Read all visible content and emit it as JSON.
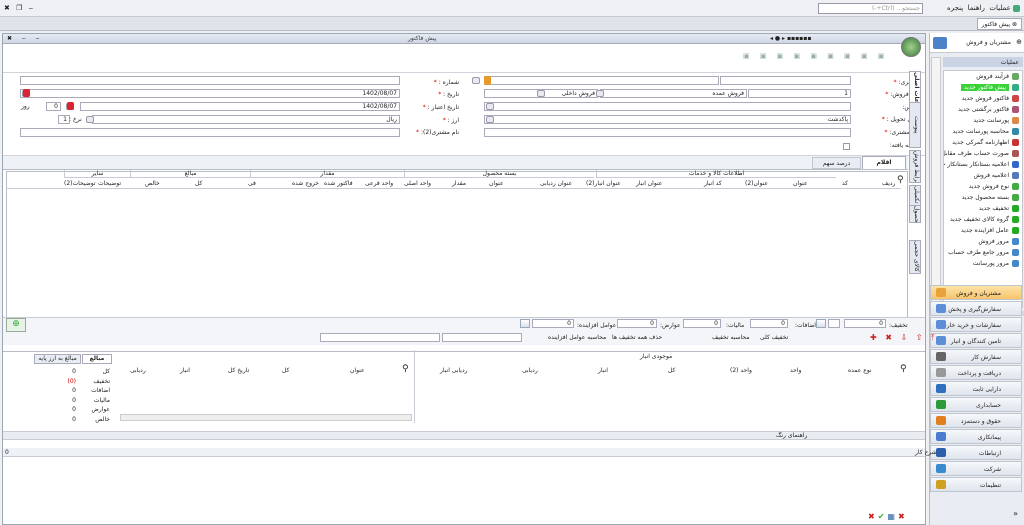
{
  "app": {
    "menus": [
      "عملیات",
      "راهنما",
      "پنجره"
    ],
    "search_placeholder": "جستجو... (Ctrl+-)",
    "doc_tab": "پیش فاکتور"
  },
  "nav": {
    "title": "مشتریان و فروش",
    "section": "عملیات",
    "items": [
      "فرآیند فروش",
      "پیش فاکتور جدید",
      "فاکتور فروش جدید",
      "فاکتور برگشتی جدید",
      "پورسانت جدید",
      "محاسبه پورسانت جدید",
      "اظهارنامه گمرکی جدید",
      "صورت حساب طرف مقابل جدید",
      "اعلامیه بستانکار بستانکار جدید",
      "اعلامیه فروش",
      "نوع فروش جدید",
      "بسته محصول جدید",
      "تخفیف جدید",
      "گروه کالای تخفیف جدید",
      "عامل افزاینده جدید",
      "مرور فروش",
      "مرور جامع طرف حساب",
      "مرور پورسانت"
    ],
    "modules": [
      "مشتریان و فروش",
      "سفارش‌گیری و پخش",
      "سفارشات و خرید خارجی",
      "تامین کنندگان و انبار",
      "سفارش کار",
      "دریافت و پرداخت",
      "دارایی ثابت",
      "حسابداری",
      "حقوق و دستمزد",
      "پیمانکاری",
      "ارتباطات",
      "شرکت",
      "تنظیمات"
    ]
  },
  "form": {
    "window_title": "پیش فاکتور",
    "customer_label": "مشتری:",
    "sale_type_label": "نوع فروش:",
    "sale_type_code": "1",
    "sale_type_value": "فروش عمده",
    "sale_kind": "فروش داخلی",
    "address_label": "آدرس:",
    "delivery_label": "محل تحویل :",
    "delivery_value": "پاکدشت",
    "customer_name_label": "نام مشتری:",
    "end_label": "خاتمه یافته:",
    "number_label": "شماره :",
    "date_label": "تاریخ :",
    "date_value": "1402/08/07",
    "validity_label": "تاریخ اعتبار :",
    "validity_value": "1402/08/07",
    "days_value": "0",
    "days_label": "روز",
    "currency_label": "ارز :",
    "currency_value": "ریال",
    "rate_label": "نرخ :",
    "rate_value": "1",
    "customer2_label": "نام مشتری(2):"
  },
  "items_tabs": [
    "اقلام",
    "درصد سهم"
  ],
  "side_tabs": [
    "اطلاعات اصلی",
    "پیوست",
    "شرایط فروش",
    "اطلاعات تکمیلی",
    "بسته محصول",
    "جوایز کالای حجمی"
  ],
  "grid": {
    "groups": [
      "اطلاعات کالا و خدمات",
      "بسته محصول",
      "مقدار",
      "مبالغ",
      "سایر"
    ],
    "cols": [
      "ردیف",
      "کد",
      "عنوان",
      "عنوان(2)",
      "کد انبار",
      "عنوان انبار",
      "عنوان انبار(2)",
      "عنوان ردیابی",
      "عنوان",
      "مقدار",
      "واحد اصلی",
      "واحد فرعی",
      "فاکتور شده",
      "خروج شده",
      "فی",
      "کل",
      "خالص",
      "توضیحات",
      "توضیحات(2)"
    ]
  },
  "totals": {
    "discount_label": "تخفیف:",
    "discount": "0",
    "additions_label": "اضافات:",
    "taxes_label": "عوارض:",
    "taxes": "0",
    "vat_label": "مالیات:",
    "vat": "0",
    "addition2": "0",
    "incr_label": "عوامل افزاینده:",
    "incr": "0"
  },
  "actions": [
    "تخفیف کلی",
    "محاسبه تخفیف",
    "حذف همه تخفیف ها",
    "محاسبه عوامل افزاینده",
    "حذف عوامل افزاینده"
  ],
  "stock": {
    "title": "موجودی انبار",
    "cols": [
      "نوع عمده",
      "واحد",
      "واحد (2)",
      "کل",
      "انبار",
      "ردیابی",
      "ردیابی انبار"
    ],
    "cols2": [
      "عنوان",
      "کل",
      "تاریخ کل",
      "انبار",
      "ردیابی"
    ]
  },
  "summary": {
    "tabs": [
      "مبالغ",
      "مبالغ به ارز پایه"
    ],
    "rows": [
      {
        "k": "کل",
        "v": "0"
      },
      {
        "k": "تخفیف",
        "v": "(0)"
      },
      {
        "k": "اضافات",
        "v": "0"
      },
      {
        "k": "مالیات",
        "v": "0"
      },
      {
        "k": "عوارض",
        "v": "0"
      },
      {
        "k": "خالص",
        "v": "0"
      }
    ]
  },
  "color_guide": "راهنمای رنگ",
  "notes_label": "شرح کار",
  "notes_count": "0"
}
